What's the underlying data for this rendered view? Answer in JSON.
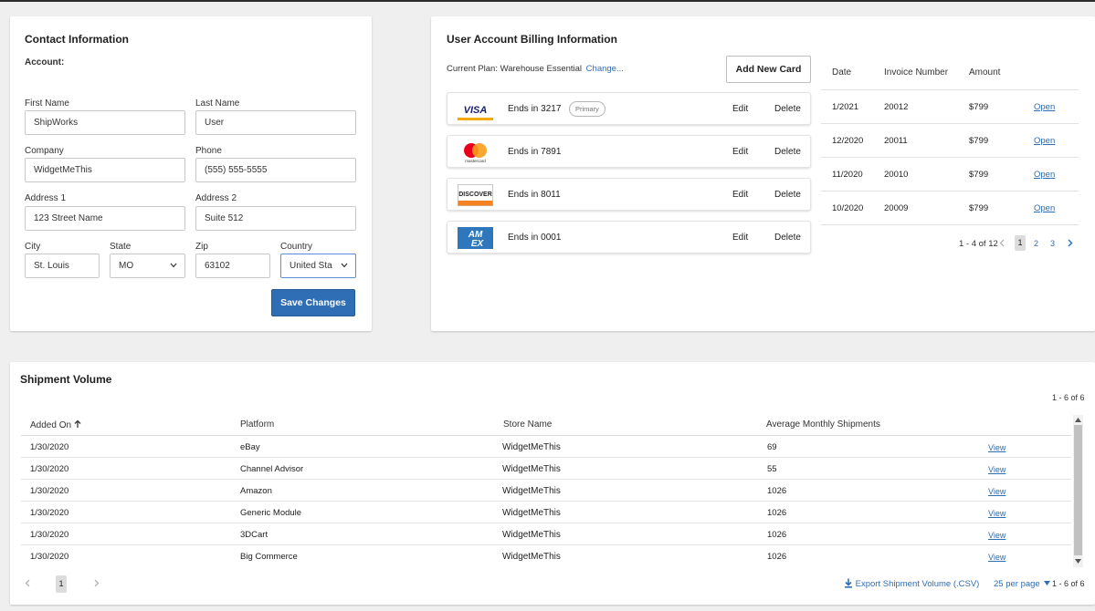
{
  "contact": {
    "title": "Contact Information",
    "account_label": "Account:",
    "first_name_label": "First Name",
    "first_name": "ShipWorks",
    "last_name_label": "Last Name",
    "last_name": "User",
    "company_label": "Company",
    "company": "WidgetMeThis",
    "phone_label": "Phone",
    "phone": "(555) 555-5555",
    "address1_label": "Address 1",
    "address1": "123 Street Name",
    "address2_label": "Address 2",
    "address2": "Suite 512",
    "city_label": "City",
    "city": "St. Louis",
    "state_label": "State",
    "state": "MO",
    "zip_label": "Zip",
    "zip": "63102",
    "country_label": "Country",
    "country": "United Sta",
    "save_label": "Save Changes"
  },
  "billing": {
    "title": "User Account Billing Information",
    "current_plan_label": "Current Plan: Warehouse Essential",
    "change_label": "Change...",
    "add_card_label": "Add New Card",
    "primary_badge": "Primary",
    "edit_label": "Edit",
    "delete_label": "Delete",
    "cards": [
      {
        "brand": "visa",
        "ends": "Ends in 3217"
      },
      {
        "brand": "mastercard",
        "ends": "Ends in 7891"
      },
      {
        "brand": "discover",
        "ends": "Ends in 8011"
      },
      {
        "brand": "amex",
        "ends": "Ends in 0001"
      }
    ],
    "logos": {
      "visa": "VISA",
      "mastercard": "mastercard",
      "discover": "DISCOVER",
      "amex_top": "AM",
      "amex_bottom": "EX"
    },
    "invoice_headers": {
      "date": "Date",
      "number": "Invoice Number",
      "amount": "Amount"
    },
    "invoices": [
      {
        "date": "1/2021",
        "number": "20012",
        "amount": "$799",
        "action": "Open"
      },
      {
        "date": "12/2020",
        "number": "20011",
        "amount": "$799",
        "action": "Open"
      },
      {
        "date": "11/2020",
        "number": "20010",
        "amount": "$799",
        "action": "Open"
      },
      {
        "date": "10/2020",
        "number": "20009",
        "amount": "$799",
        "action": "Open"
      }
    ],
    "pagination": {
      "range": "1 - 4 of 12",
      "pages": [
        "1",
        "2",
        "3"
      ],
      "current": "1"
    }
  },
  "shipment": {
    "title": "Shipment Volume",
    "range_top": "1 - 6 of 6",
    "headers": {
      "added_on": "Added On",
      "platform": "Platform",
      "store": "Store Name",
      "avg": "Average Monthly Shipments"
    },
    "rows": [
      {
        "added": "1/30/2020",
        "platform": "eBay",
        "store": "WidgetMeThis",
        "avg": "69",
        "action": "View"
      },
      {
        "added": "1/30/2020",
        "platform": "Channel Advisor",
        "store": "WidgetMeThis",
        "avg": "55",
        "action": "View"
      },
      {
        "added": "1/30/2020",
        "platform": "Amazon",
        "store": "WidgetMeThis",
        "avg": "1026",
        "action": "View"
      },
      {
        "added": "1/30/2020",
        "platform": "Generic Module",
        "store": "WidgetMeThis",
        "avg": "1026",
        "action": "View"
      },
      {
        "added": "1/30/2020",
        "platform": "3DCart",
        "store": "WidgetMeThis",
        "avg": "1026",
        "action": "View"
      },
      {
        "added": "1/30/2020",
        "platform": "Big Commerce",
        "store": "WidgetMeThis",
        "avg": "1026",
        "action": "View"
      }
    ],
    "page": "1",
    "export_label": "Export Shipment Volume (.CSV)",
    "per_page": "25 per page",
    "range_bottom": "1 - 6 of 6"
  },
  "colors": {
    "accent": "#2f6db5",
    "background": "#efefef"
  }
}
